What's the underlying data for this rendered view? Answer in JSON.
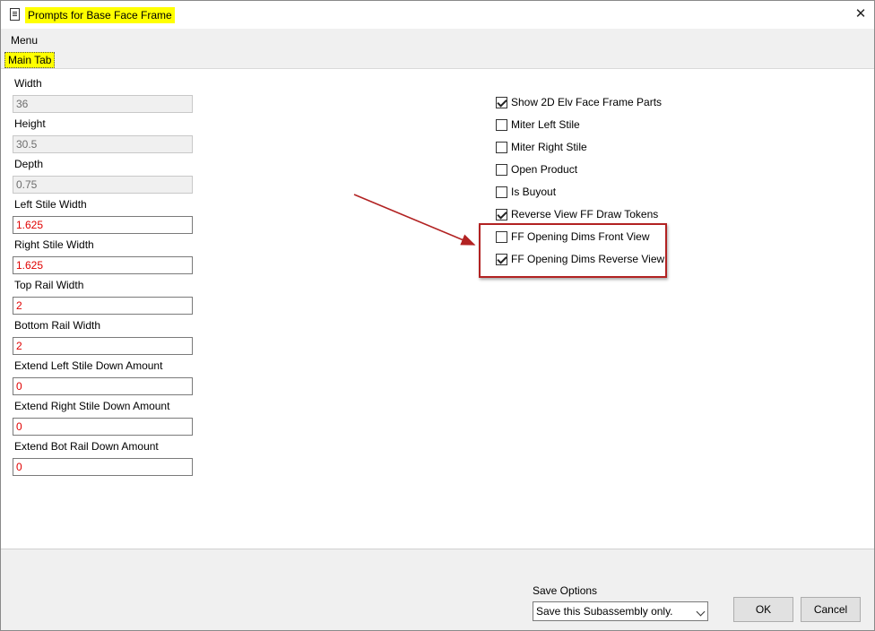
{
  "window": {
    "title": "Prompts for Base Face Frame",
    "icon": "document-icon",
    "close_glyph": "✕"
  },
  "menu": {
    "label": "Menu"
  },
  "tabs": [
    {
      "label": "Main Tab",
      "highlight": "#ffff00"
    }
  ],
  "fields": [
    {
      "label": "Width",
      "value": "36",
      "readonly": true
    },
    {
      "label": "Height",
      "value": "30.5",
      "readonly": true
    },
    {
      "label": "Depth",
      "value": "0.75",
      "readonly": true
    },
    {
      "label": "Left Stile Width",
      "value": "1.625",
      "readonly": false
    },
    {
      "label": "Right Stile Width",
      "value": "1.625",
      "readonly": false
    },
    {
      "label": "Top Rail Width",
      "value": "2",
      "readonly": false
    },
    {
      "label": "Bottom Rail Width",
      "value": "2",
      "readonly": false
    },
    {
      "label": "Extend Left Stile Down Amount",
      "value": "0",
      "readonly": false
    },
    {
      "label": "Extend Right Stile Down Amount",
      "value": "0",
      "readonly": false
    },
    {
      "label": "Extend Bot Rail Down Amount",
      "value": "0",
      "readonly": false
    }
  ],
  "checkboxes": [
    {
      "label": "Show 2D Elv Face Frame Parts",
      "checked": true
    },
    {
      "label": "Miter Left Stile",
      "checked": false
    },
    {
      "label": "Miter Right Stile",
      "checked": false
    },
    {
      "label": "Open Product",
      "checked": false
    },
    {
      "label": "Is Buyout",
      "checked": false
    },
    {
      "label": "Reverse View FF Draw Tokens",
      "checked": true
    },
    {
      "label": "FF Opening Dims Front View",
      "checked": false
    },
    {
      "label": "FF Opening Dims Reverse View",
      "checked": true
    }
  ],
  "annotation": {
    "color": "#b22222"
  },
  "footer": {
    "save_options_label": "Save Options",
    "save_options_value": "Save this Subassembly only.",
    "ok_label": "OK",
    "cancel_label": "Cancel"
  },
  "colors": {
    "title_highlight": "#ffff00",
    "field_value": "#e00000",
    "chrome": "#f0f0f0"
  }
}
